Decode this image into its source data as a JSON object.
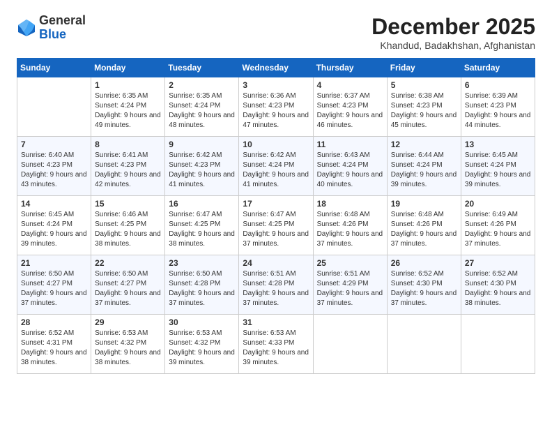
{
  "header": {
    "logo_general": "General",
    "logo_blue": "Blue",
    "month_title": "December 2025",
    "location": "Khandud, Badakhshan, Afghanistan"
  },
  "days_of_week": [
    "Sunday",
    "Monday",
    "Tuesday",
    "Wednesday",
    "Thursday",
    "Friday",
    "Saturday"
  ],
  "weeks": [
    [
      {
        "day": "",
        "info": ""
      },
      {
        "day": "1",
        "info": "Sunrise: 6:35 AM\nSunset: 4:24 PM\nDaylight: 9 hours\nand 49 minutes."
      },
      {
        "day": "2",
        "info": "Sunrise: 6:35 AM\nSunset: 4:24 PM\nDaylight: 9 hours\nand 48 minutes."
      },
      {
        "day": "3",
        "info": "Sunrise: 6:36 AM\nSunset: 4:23 PM\nDaylight: 9 hours\nand 47 minutes."
      },
      {
        "day": "4",
        "info": "Sunrise: 6:37 AM\nSunset: 4:23 PM\nDaylight: 9 hours\nand 46 minutes."
      },
      {
        "day": "5",
        "info": "Sunrise: 6:38 AM\nSunset: 4:23 PM\nDaylight: 9 hours\nand 45 minutes."
      },
      {
        "day": "6",
        "info": "Sunrise: 6:39 AM\nSunset: 4:23 PM\nDaylight: 9 hours\nand 44 minutes."
      }
    ],
    [
      {
        "day": "7",
        "info": "Sunrise: 6:40 AM\nSunset: 4:23 PM\nDaylight: 9 hours\nand 43 minutes."
      },
      {
        "day": "8",
        "info": "Sunrise: 6:41 AM\nSunset: 4:23 PM\nDaylight: 9 hours\nand 42 minutes."
      },
      {
        "day": "9",
        "info": "Sunrise: 6:42 AM\nSunset: 4:23 PM\nDaylight: 9 hours\nand 41 minutes."
      },
      {
        "day": "10",
        "info": "Sunrise: 6:42 AM\nSunset: 4:24 PM\nDaylight: 9 hours\nand 41 minutes."
      },
      {
        "day": "11",
        "info": "Sunrise: 6:43 AM\nSunset: 4:24 PM\nDaylight: 9 hours\nand 40 minutes."
      },
      {
        "day": "12",
        "info": "Sunrise: 6:44 AM\nSunset: 4:24 PM\nDaylight: 9 hours\nand 39 minutes."
      },
      {
        "day": "13",
        "info": "Sunrise: 6:45 AM\nSunset: 4:24 PM\nDaylight: 9 hours\nand 39 minutes."
      }
    ],
    [
      {
        "day": "14",
        "info": "Sunrise: 6:45 AM\nSunset: 4:24 PM\nDaylight: 9 hours\nand 39 minutes."
      },
      {
        "day": "15",
        "info": "Sunrise: 6:46 AM\nSunset: 4:25 PM\nDaylight: 9 hours\nand 38 minutes."
      },
      {
        "day": "16",
        "info": "Sunrise: 6:47 AM\nSunset: 4:25 PM\nDaylight: 9 hours\nand 38 minutes."
      },
      {
        "day": "17",
        "info": "Sunrise: 6:47 AM\nSunset: 4:25 PM\nDaylight: 9 hours\nand 37 minutes."
      },
      {
        "day": "18",
        "info": "Sunrise: 6:48 AM\nSunset: 4:26 PM\nDaylight: 9 hours\nand 37 minutes."
      },
      {
        "day": "19",
        "info": "Sunrise: 6:48 AM\nSunset: 4:26 PM\nDaylight: 9 hours\nand 37 minutes."
      },
      {
        "day": "20",
        "info": "Sunrise: 6:49 AM\nSunset: 4:26 PM\nDaylight: 9 hours\nand 37 minutes."
      }
    ],
    [
      {
        "day": "21",
        "info": "Sunrise: 6:50 AM\nSunset: 4:27 PM\nDaylight: 9 hours\nand 37 minutes."
      },
      {
        "day": "22",
        "info": "Sunrise: 6:50 AM\nSunset: 4:27 PM\nDaylight: 9 hours\nand 37 minutes."
      },
      {
        "day": "23",
        "info": "Sunrise: 6:50 AM\nSunset: 4:28 PM\nDaylight: 9 hours\nand 37 minutes."
      },
      {
        "day": "24",
        "info": "Sunrise: 6:51 AM\nSunset: 4:28 PM\nDaylight: 9 hours\nand 37 minutes."
      },
      {
        "day": "25",
        "info": "Sunrise: 6:51 AM\nSunset: 4:29 PM\nDaylight: 9 hours\nand 37 minutes."
      },
      {
        "day": "26",
        "info": "Sunrise: 6:52 AM\nSunset: 4:30 PM\nDaylight: 9 hours\nand 37 minutes."
      },
      {
        "day": "27",
        "info": "Sunrise: 6:52 AM\nSunset: 4:30 PM\nDaylight: 9 hours\nand 38 minutes."
      }
    ],
    [
      {
        "day": "28",
        "info": "Sunrise: 6:52 AM\nSunset: 4:31 PM\nDaylight: 9 hours\nand 38 minutes."
      },
      {
        "day": "29",
        "info": "Sunrise: 6:53 AM\nSunset: 4:32 PM\nDaylight: 9 hours\nand 38 minutes."
      },
      {
        "day": "30",
        "info": "Sunrise: 6:53 AM\nSunset: 4:32 PM\nDaylight: 9 hours\nand 39 minutes."
      },
      {
        "day": "31",
        "info": "Sunrise: 6:53 AM\nSunset: 4:33 PM\nDaylight: 9 hours\nand 39 minutes."
      },
      {
        "day": "",
        "info": ""
      },
      {
        "day": "",
        "info": ""
      },
      {
        "day": "",
        "info": ""
      }
    ]
  ]
}
